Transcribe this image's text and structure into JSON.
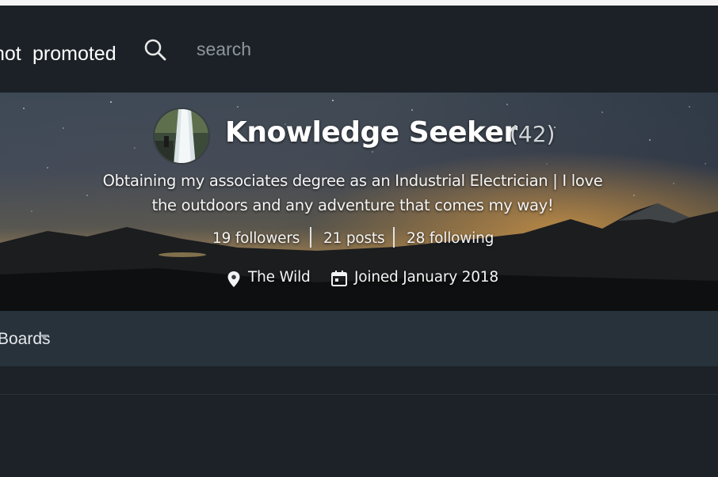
{
  "nav": {
    "hot_label": "hot",
    "promoted_label": "promoted",
    "search_placeholder": "search",
    "search_icon": "search-icon"
  },
  "profile": {
    "name": "Knowledge Seeker",
    "reputation": "(42)",
    "bio": "Obtaining my associates degree as an Industrial Electrician | I love the outdoors and any adventure that comes my way!",
    "followers": "19 followers",
    "posts": "21 posts",
    "following": "28 following",
    "location": "The Wild",
    "joined": "Joined January 2018"
  },
  "tabs": {
    "boards_label": "Boards"
  },
  "colors": {
    "nav_bg": "#1b2126",
    "tabbar_bg": "#27323b",
    "content_bg": "#1c2227"
  }
}
